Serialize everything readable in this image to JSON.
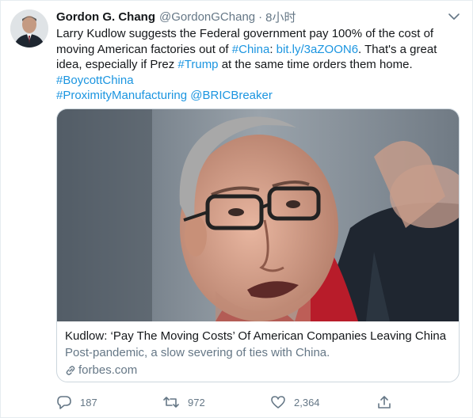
{
  "tweet": {
    "author_name": "Gordon G. Chang",
    "author_handle": "@GordonGChang",
    "separator": "·",
    "time": "8小时",
    "text_parts": {
      "p1": "Larry Kudlow suggests the Federal government pay 100% of the cost of moving American factories out of ",
      "china_tag": "#China",
      "p2": ": ",
      "link": "bit.ly/3aZOON6",
      "p3": ". That's a great idea, especially if Prez ",
      "trump_tag": "#Trump",
      "p4": " at the same time orders them home. ",
      "boycott_tag": "#BoycottChina",
      "proximity_tag": "#ProximityManufacturing",
      "mention": "@BRICBreaker"
    }
  },
  "card": {
    "title": "Kudlow:  ‘Pay The Moving Costs’  Of American Companies Leaving China",
    "description": "Post-pandemic, a slow severing of ties with China.",
    "domain": "forbes.com"
  },
  "actions": {
    "reply_count": "187",
    "retweet_count": "972",
    "like_count": "2,364"
  },
  "colors": {
    "link": "#1b95e0",
    "secondary_text": "#657786",
    "border": "#ccd6dd"
  }
}
